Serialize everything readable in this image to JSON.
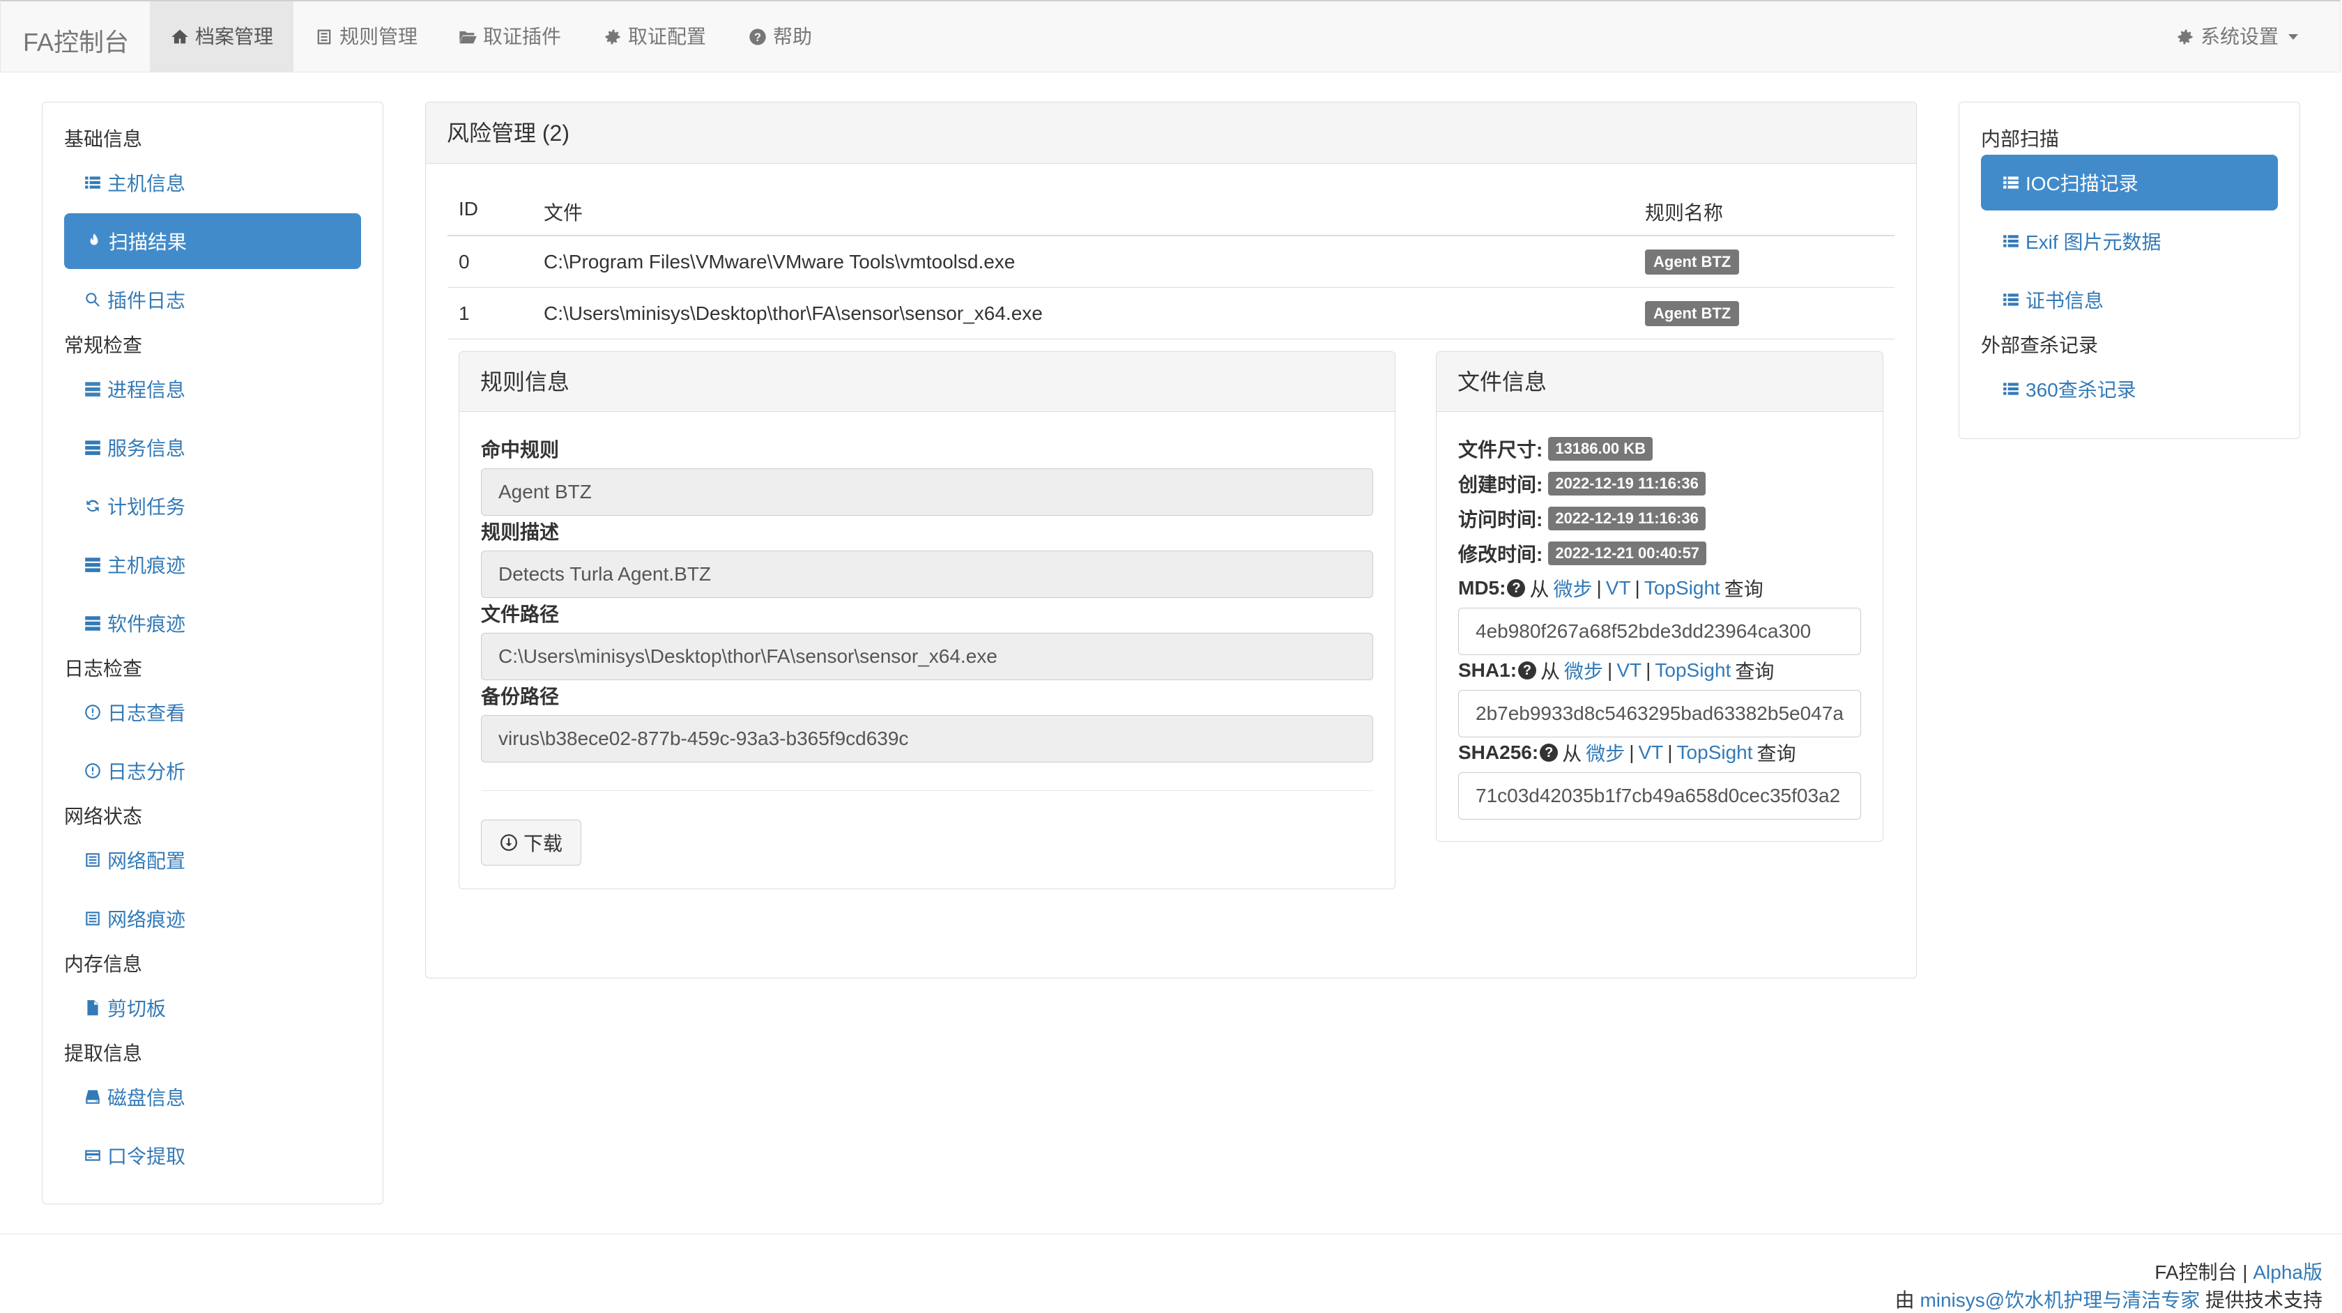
{
  "navbar": {
    "brand": "FA控制台",
    "items": [
      {
        "label": "档案管理",
        "icon": "home-icon"
      },
      {
        "label": "规则管理",
        "icon": "list-icon"
      },
      {
        "label": "取证插件",
        "icon": "folder-open-icon"
      },
      {
        "label": "取证配置",
        "icon": "gear-icon"
      },
      {
        "label": "帮助",
        "icon": "question-circle-icon"
      }
    ],
    "settings": {
      "label": "系统设置",
      "icon": "gear-icon"
    }
  },
  "sidebar": {
    "groups": [
      {
        "title": "基础信息",
        "items": [
          {
            "label": "主机信息",
            "icon": "list-icon"
          },
          {
            "label": "扫描结果",
            "icon": "fire-icon"
          },
          {
            "label": "插件日志",
            "icon": "search-icon"
          }
        ]
      },
      {
        "title": "常规检查",
        "items": [
          {
            "label": "进程信息",
            "icon": "tasks-icon"
          },
          {
            "label": "服务信息",
            "icon": "tasks-icon"
          },
          {
            "label": "计划任务",
            "icon": "refresh-icon"
          },
          {
            "label": "主机痕迹",
            "icon": "tasks-icon"
          },
          {
            "label": "软件痕迹",
            "icon": "tasks-icon"
          }
        ]
      },
      {
        "title": "日志检查",
        "items": [
          {
            "label": "日志查看",
            "icon": "dashboard-icon"
          },
          {
            "label": "日志分析",
            "icon": "dashboard-icon"
          }
        ]
      },
      {
        "title": "网络状态",
        "items": [
          {
            "label": "网络配置",
            "icon": "list-alt-icon"
          },
          {
            "label": "网络痕迹",
            "icon": "list-alt-icon"
          }
        ]
      },
      {
        "title": "内存信息",
        "items": [
          {
            "label": "剪切板",
            "icon": "file-icon"
          }
        ]
      },
      {
        "title": "提取信息",
        "items": [
          {
            "label": "磁盘信息",
            "icon": "hdd-icon"
          },
          {
            "label": "口令提取",
            "icon": "credit-card-icon"
          }
        ]
      }
    ]
  },
  "risk_panel": {
    "title": "风险管理 (2)",
    "columns": [
      "ID",
      "文件",
      "规则名称"
    ],
    "rows": [
      {
        "id": "0",
        "file": "C:\\Program Files\\VMware\\VMware Tools\\vmtoolsd.exe",
        "rule": "Agent BTZ"
      },
      {
        "id": "1",
        "file": "C:\\Users\\minisys\\Desktop\\thor\\FA\\sensor\\sensor_x64.exe",
        "rule": "Agent BTZ"
      }
    ]
  },
  "rule_info": {
    "title": "规则信息",
    "hit_rule_label": "命中规则",
    "hit_rule_value": "Agent BTZ",
    "desc_label": "规则描述",
    "desc_value": "Detects Turla Agent.BTZ",
    "path_label": "文件路径",
    "path_value": "C:\\Users\\minisys\\Desktop\\thor\\FA\\sensor\\sensor_x64.exe",
    "backup_label": "备份路径",
    "backup_value": "virus\\b38ece02-877b-459c-93a3-b365f9cd639c",
    "download_label": "下载"
  },
  "file_info": {
    "title": "文件信息",
    "size_label": "文件尺寸:",
    "size_value": "13186.00 KB",
    "created_label": "创建时间:",
    "created_value": "2022-12-19 11:16:36",
    "accessed_label": "访问时间:",
    "accessed_value": "2022-12-19 11:16:36",
    "modified_label": "修改时间:",
    "modified_value": "2022-12-21 00:40:57",
    "from_word": "从",
    "query_word": "查询",
    "link_weibu": "微步",
    "link_vt": "VT",
    "link_topsight": "TopSight",
    "sep": "|",
    "md5_label": "MD5:",
    "md5_value": "4eb980f267a68f52bde3dd23964ca300",
    "sha1_label": "SHA1:",
    "sha1_value": "2b7eb9933d8c5463295bad63382b5e047a",
    "sha256_label": "SHA256:",
    "sha256_value": "71c03d42035b1f7cb49a658d0cec35f03a2"
  },
  "right_sidebar": {
    "groups": [
      {
        "title": "内部扫描",
        "items": [
          {
            "label": "IOC扫描记录",
            "icon": "list-icon"
          },
          {
            "label": "Exif 图片元数据",
            "icon": "list-icon"
          },
          {
            "label": "证书信息",
            "icon": "list-icon"
          }
        ]
      },
      {
        "title": "外部查杀记录",
        "items": [
          {
            "label": "360查杀记录",
            "icon": "list-icon"
          }
        ]
      }
    ]
  },
  "footer": {
    "line1_text": "FA控制台 |",
    "line1_link": "Alpha版",
    "line2_prefix": "由",
    "line2_link": "minisys@饮水机护理与清洁专家",
    "line2_suffix": "提供技术支持"
  }
}
